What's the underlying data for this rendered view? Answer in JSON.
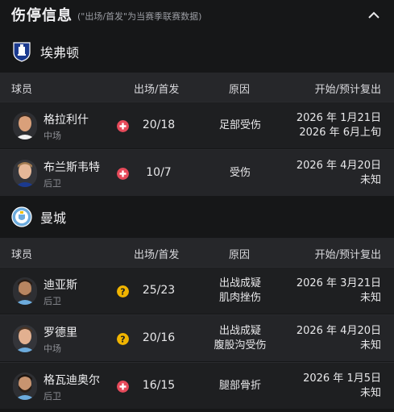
{
  "header": {
    "title": "伤停信息",
    "subtitle": "(\"出场/首发\"为当赛季联赛数据)"
  },
  "columns": {
    "player": "球员",
    "apps": "出场/首发",
    "reason": "原因",
    "dates": "开始/预计复出"
  },
  "colors": {
    "injury": "#e64a5a",
    "doubtful": "#f0b400",
    "everton": "#1b3a8f",
    "mancity": "#6cabdd"
  },
  "teams": [
    {
      "name": "埃弗顿",
      "crest_icon": "everton-crest-icon",
      "players": [
        {
          "name": "格拉利什",
          "position": "中场",
          "status_icon": "injury-cross-icon",
          "apps": "20/18",
          "reason": [
            "足部受伤"
          ],
          "dates": [
            "2026 年 1月21日",
            "2026 年 6月上旬"
          ]
        },
        {
          "name": "布兰斯韦特",
          "position": "后卫",
          "status_icon": "injury-cross-icon",
          "apps": "10/7",
          "reason": [
            "受伤"
          ],
          "dates": [
            "2026 年 4月20日",
            "未知"
          ]
        }
      ]
    },
    {
      "name": "曼城",
      "crest_icon": "man-city-crest-icon",
      "players": [
        {
          "name": "迪亚斯",
          "position": "后卫",
          "status_icon": "doubtful-question-icon",
          "apps": "25/23",
          "reason": [
            "出战成疑",
            "肌肉挫伤"
          ],
          "dates": [
            "2026 年 3月21日",
            "未知"
          ]
        },
        {
          "name": "罗德里",
          "position": "中场",
          "status_icon": "doubtful-question-icon",
          "apps": "20/16",
          "reason": [
            "出战成疑",
            "腹股沟受伤"
          ],
          "dates": [
            "2026 年 4月20日",
            "未知"
          ]
        },
        {
          "name": "格瓦迪奥尔",
          "position": "后卫",
          "status_icon": "injury-cross-icon",
          "apps": "16/15",
          "reason": [
            "腿部骨折"
          ],
          "dates": [
            "2026 年 1月5日",
            "未知"
          ]
        }
      ]
    }
  ]
}
